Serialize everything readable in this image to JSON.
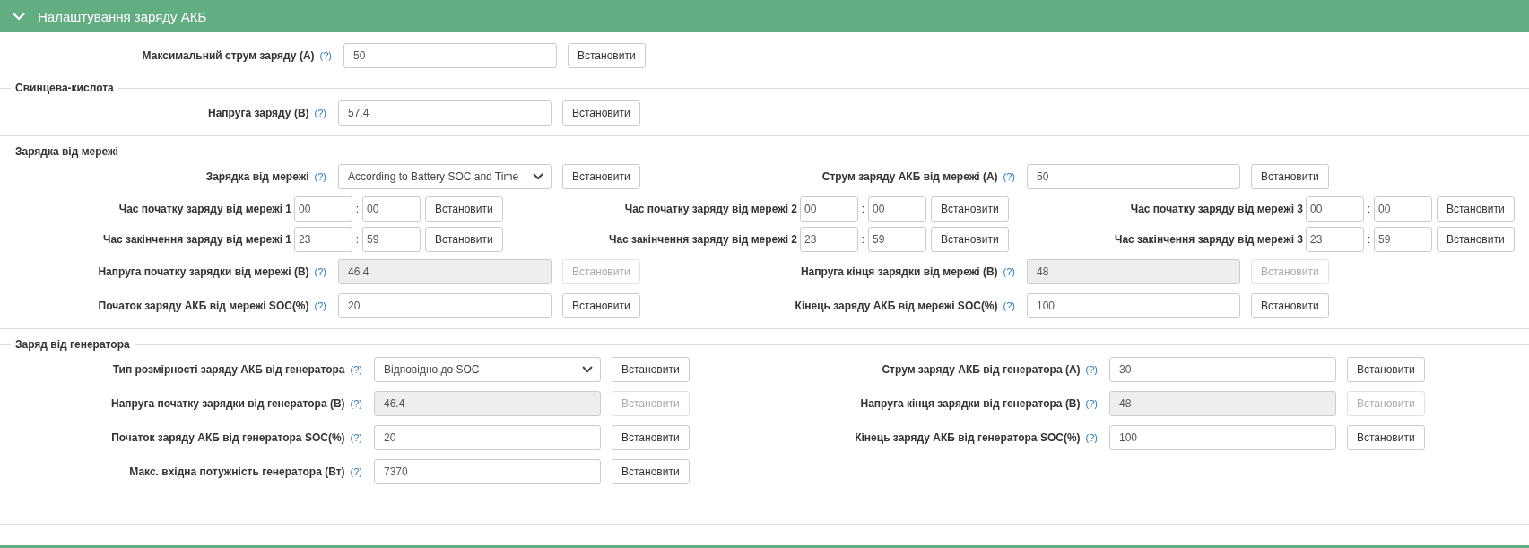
{
  "panel": {
    "title": "Налаштування заряду АКБ",
    "expanded": true
  },
  "sections": [
    {
      "lines": [
        {
          "items": [
            {
              "kind": "input",
              "label": "Максимальний струм заряду (A)",
              "help": "(?)",
              "value": "50",
              "disabled": false,
              "button": "Встановити"
            }
          ]
        }
      ]
    },
    {
      "title": "Свинцева-кислота",
      "lines": [
        {
          "items": [
            {
              "kind": "input",
              "label": "Напруга заряду (В)",
              "help": "(?)",
              "value": "57.4",
              "disabled": false,
              "button": "Встановити"
            }
          ]
        }
      ]
    },
    {
      "title": "Зарядка від мережі",
      "lines": [
        {
          "items": [
            {
              "kind": "select",
              "label": "Зарядка від мережі",
              "help": "(?)",
              "value": "According to Battery SOC and Time",
              "disabled": false,
              "button": "Встановити"
            },
            {
              "kind": "input",
              "label": "Струм заряду АКБ від мережі (A)",
              "help": "(?)",
              "value": "50",
              "disabled": false,
              "button": "Встановити"
            }
          ]
        },
        {
          "items": [
            {
              "kind": "time",
              "label": "Час початку заряду від мережі 1",
              "hours": "00",
              "separator": ":",
              "minutes": "00",
              "disabled": false,
              "button": "Встановити"
            },
            {
              "kind": "time",
              "label": "Час початку заряду від мережі 2",
              "hours": "00",
              "separator": ":",
              "minutes": "00",
              "disabled": false,
              "button": "Встановити"
            },
            {
              "kind": "time",
              "label": "Час початку заряду від мережі 3",
              "hours": "00",
              "separator": ":",
              "minutes": "00",
              "disabled": false,
              "button": "Встановити"
            }
          ]
        },
        {
          "items": [
            {
              "kind": "time",
              "label": "Час закінчення заряду від мережі 1",
              "hours": "23",
              "separator": ":",
              "minutes": "59",
              "disabled": false,
              "button": "Встановити"
            },
            {
              "kind": "time",
              "label": "Час закінчення заряду від мережі 2",
              "hours": "23",
              "separator": ":",
              "minutes": "59",
              "disabled": false,
              "button": "Встановити"
            },
            {
              "kind": "time",
              "label": "Час закінчення заряду від мережі 3",
              "hours": "23",
              "separator": ":",
              "minutes": "59",
              "disabled": false,
              "button": "Встановити"
            }
          ]
        },
        {
          "items": [
            {
              "kind": "input",
              "label": "Напруга початку зарядки від мережі (В)",
              "help": "(?)",
              "value": "46.4",
              "disabled": true,
              "button": "Встановити"
            },
            {
              "kind": "input",
              "label": "Напруга кінця зарядки від мережі (В)",
              "help": "(?)",
              "value": "48",
              "disabled": true,
              "button": "Встановити"
            }
          ]
        },
        {
          "items": [
            {
              "kind": "input",
              "label": "Початок заряду АКБ від мережі SOC(%)",
              "help": "(?)",
              "value": "20",
              "disabled": false,
              "button": "Встановити"
            },
            {
              "kind": "input",
              "label": "Кінець заряду АКБ від мережі SOC(%)",
              "help": "(?)",
              "value": "100",
              "disabled": false,
              "button": "Встановити"
            }
          ]
        }
      ]
    },
    {
      "title": "Заряд від генератора",
      "lines": [
        {
          "items": [
            {
              "kind": "select",
              "label": "Тип розмірності заряду АКБ від генератора",
              "help": "(?)",
              "value": "Відповідно до SOC",
              "disabled": false,
              "button": "Встановити"
            },
            {
              "kind": "input",
              "label": "Струм заряду АКБ від генератора (A)",
              "help": "(?)",
              "value": "30",
              "disabled": false,
              "button": "Встановити"
            }
          ]
        },
        {
          "items": [
            {
              "kind": "input",
              "label": "Напруга початку зарядки від генератора (В)",
              "help": "(?)",
              "value": "46.4",
              "disabled": true,
              "button": "Встановити"
            },
            {
              "kind": "input",
              "label": "Напруга кінця зарядки від генератора (В)",
              "help": "(?)",
              "value": "48",
              "disabled": true,
              "button": "Встановити"
            }
          ]
        },
        {
          "items": [
            {
              "kind": "input",
              "label": "Початок заряду АКБ від генератора SOC(%)",
              "help": "(?)",
              "value": "20",
              "disabled": false,
              "button": "Встановити"
            },
            {
              "kind": "input",
              "label": "Кінець заряду АКБ від генератора SOC(%)",
              "help": "(?)",
              "value": "100",
              "disabled": false,
              "button": "Встановити"
            }
          ]
        },
        {
          "items": [
            {
              "kind": "input",
              "label": "Макс. вхідна потужність генератора (Вт)",
              "help": "(?)",
              "value": "7370",
              "disabled": false,
              "button": "Встановити"
            }
          ]
        }
      ]
    }
  ]
}
